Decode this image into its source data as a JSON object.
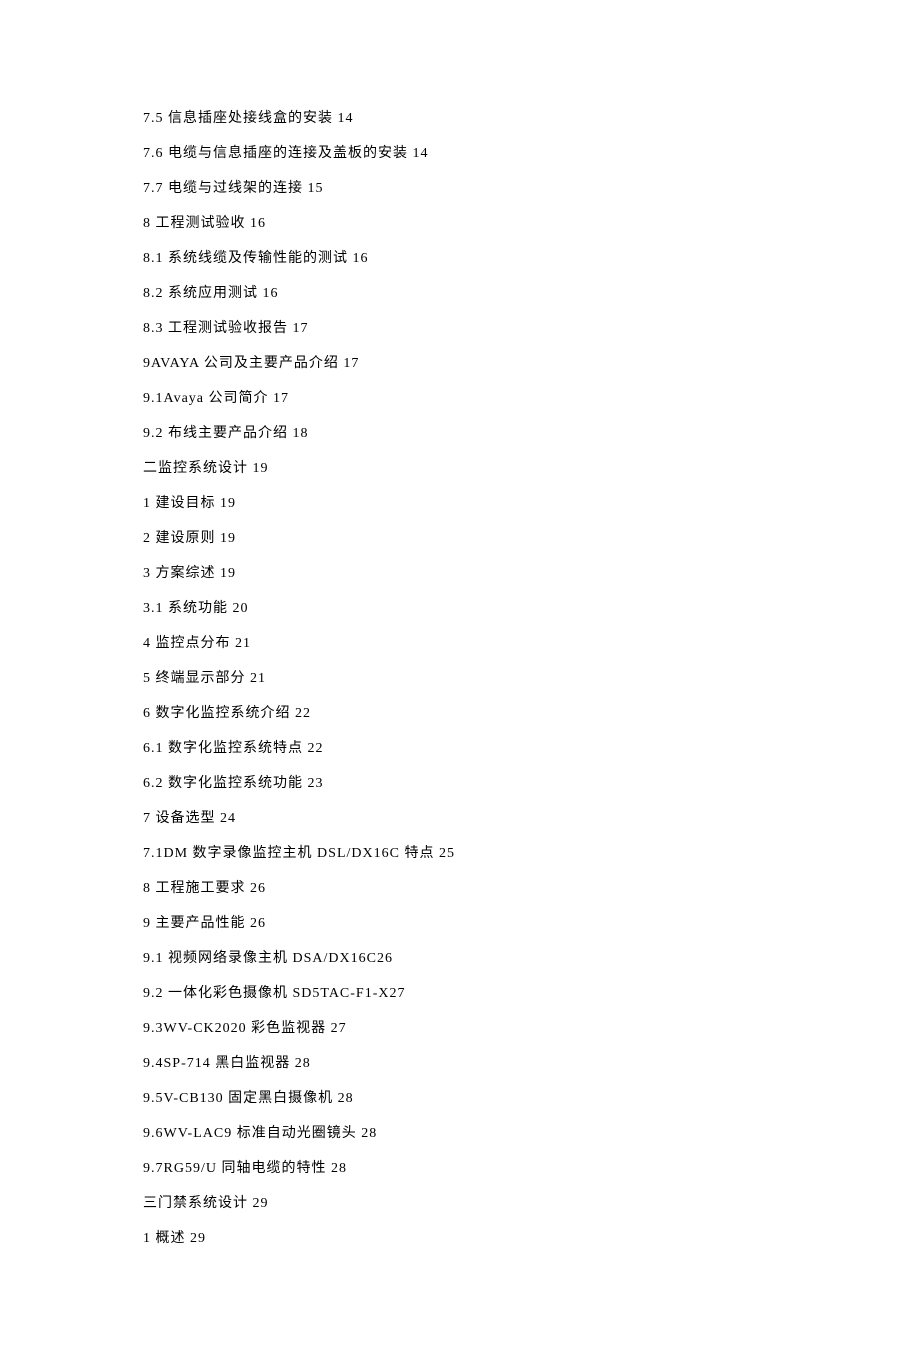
{
  "toc": [
    "7.5 信息插座处接线盒的安装 14",
    "7.6 电缆与信息插座的连接及盖板的安装 14",
    "7.7 电缆与过线架的连接 15",
    "8 工程测试验收 16",
    "8.1 系统线缆及传输性能的测试 16",
    "8.2 系统应用测试 16",
    "8.3 工程测试验收报告 17",
    "9AVAYA 公司及主要产品介绍 17",
    "9.1Avaya 公司简介 17",
    "9.2 布线主要产品介绍 18",
    "二监控系统设计 19",
    "1 建设目标 19",
    "2 建设原则 19",
    "3 方案综述 19",
    "3.1 系统功能 20",
    "4 监控点分布 21",
    "5 终端显示部分 21",
    "6 数字化监控系统介绍 22",
    "6.1 数字化监控系统特点 22",
    "6.2 数字化监控系统功能 23",
    "7 设备选型 24",
    "7.1DM 数字录像监控主机 DSL/DX16C 特点 25",
    "8 工程施工要求 26",
    "9 主要产品性能 26",
    "9.1 视频网络录像主机 DSA/DX16C26",
    "9.2 一体化彩色摄像机 SD5TAC-F1-X27",
    "9.3WV-CK2020 彩色监视器 27",
    "9.4SP-714 黑白监视器 28",
    "9.5V-CB130 固定黑白摄像机 28",
    "9.6WV-LAC9 标准自动光圈镜头 28",
    "9.7RG59/U 同轴电缆的特性 28",
    "三门禁系统设计 29",
    "1 概述 29"
  ]
}
